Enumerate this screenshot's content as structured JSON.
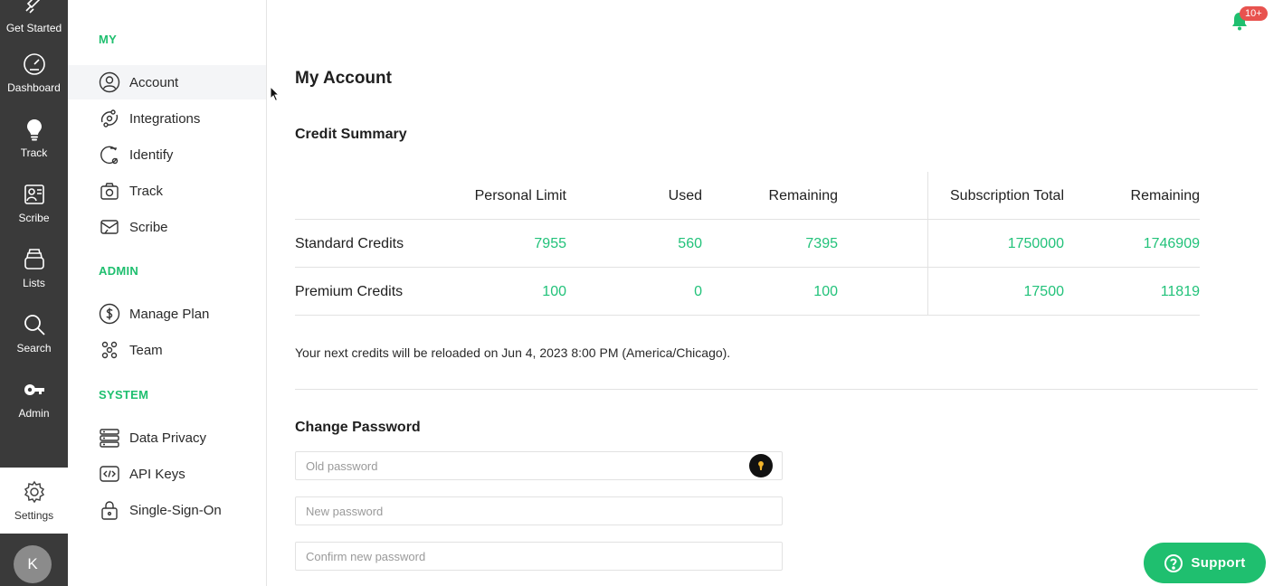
{
  "rail": {
    "items": [
      {
        "label": "Get Started",
        "icon": "rocket-icon"
      },
      {
        "label": "Dashboard",
        "icon": "gauge-icon"
      },
      {
        "label": "Track",
        "icon": "lightbulb-icon"
      },
      {
        "label": "Scribe",
        "icon": "scribe-icon"
      },
      {
        "label": "Lists",
        "icon": "lists-icon"
      },
      {
        "label": "Search",
        "icon": "search-icon"
      },
      {
        "label": "Admin",
        "icon": "key-icon"
      },
      {
        "label": "Settings",
        "icon": "gear-icon"
      }
    ],
    "avatar_initial": "K"
  },
  "sidebar": {
    "sections": [
      {
        "title": "MY",
        "items": [
          {
            "label": "Account",
            "icon": "user-circle-icon",
            "active": true
          },
          {
            "label": "Integrations",
            "icon": "integrations-icon"
          },
          {
            "label": "Identify",
            "icon": "identify-icon"
          },
          {
            "label": "Track",
            "icon": "track-icon"
          },
          {
            "label": "Scribe",
            "icon": "mail-icon"
          }
        ]
      },
      {
        "title": "ADMIN",
        "items": [
          {
            "label": "Manage Plan",
            "icon": "dollar-icon"
          },
          {
            "label": "Team",
            "icon": "team-icon"
          }
        ]
      },
      {
        "title": "SYSTEM",
        "items": [
          {
            "label": "Data Privacy",
            "icon": "server-icon"
          },
          {
            "label": "API Keys",
            "icon": "code-icon"
          },
          {
            "label": "Single-Sign-On",
            "icon": "lock-icon"
          }
        ]
      }
    ]
  },
  "header": {
    "notification_badge": "10+"
  },
  "main": {
    "title": "My Account",
    "credit_summary": {
      "heading": "Credit Summary",
      "columns": [
        "Personal Limit",
        "Used",
        "Remaining",
        "Subscription Total",
        "Remaining"
      ],
      "rows": [
        {
          "label": "Standard Credits",
          "values": [
            "7955",
            "560",
            "7395",
            "1750000",
            "1746909"
          ]
        },
        {
          "label": "Premium Credits",
          "values": [
            "100",
            "0",
            "100",
            "17500",
            "11819"
          ]
        }
      ],
      "note": "Your next credits will be reloaded on Jun 4, 2023 8:00 PM (America/Chicago)."
    },
    "change_password": {
      "heading": "Change Password",
      "old_placeholder": "Old password",
      "new_placeholder": "New password",
      "confirm_placeholder": "Confirm new password"
    }
  },
  "support": {
    "label": "Support"
  },
  "colors": {
    "accent": "#1fbf6f",
    "rail_bg": "#3a3a3a",
    "badge": "#e8534f"
  }
}
